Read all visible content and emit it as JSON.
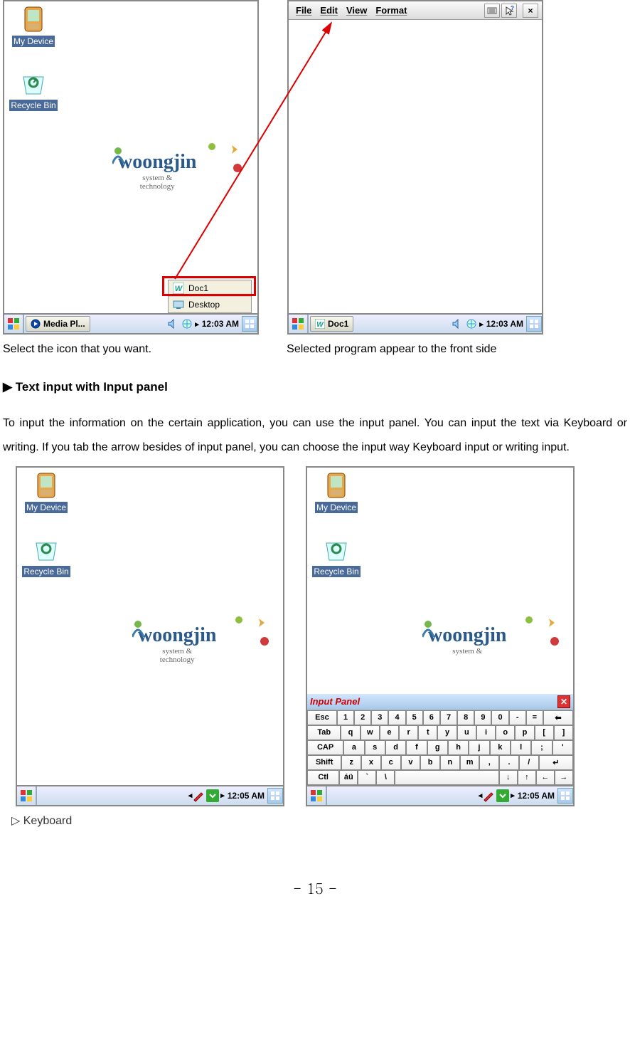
{
  "row1": {
    "leftDevice": {
      "icons": {
        "myDevice": "My Device",
        "recycleBin": "Recycle Bin"
      },
      "logo": {
        "brand": "woongjin",
        "sub": "system &\ntechnology"
      },
      "popup": {
        "doc": "Doc1",
        "desktop": "Desktop"
      },
      "taskbar": {
        "task": "Media Pl...",
        "time": "12:03 AM"
      },
      "caption": "Select the icon that you want."
    },
    "rightDevice": {
      "menu": {
        "file": "File",
        "edit": "Edit",
        "view": "View",
        "format": "Format"
      },
      "closeX": "×",
      "taskbar": {
        "task": "Doc1",
        "time": "12:03 AM"
      },
      "caption": "Selected program appear to the front side"
    }
  },
  "heading1": "▶ Text input with Input panel",
  "para1": "To input the information on the certain application, you can use the input panel. You can input the text via Keyboard or writing. If you tab the arrow besides of input panel, you can choose the input way Keyboard input or writing input.",
  "row2": {
    "leftDevice": {
      "icons": {
        "myDevice": "My Device",
        "recycleBin": "Recycle Bin"
      },
      "logo": {
        "brand": "woongjin",
        "sub": "system &\ntechnology"
      },
      "taskbar": {
        "time": "12:05 AM"
      }
    },
    "rightDevice": {
      "icons": {
        "myDevice": "My Device",
        "recycleBin": "Recycle Bin"
      },
      "logo": {
        "brand": "woongjin",
        "sub": "system &"
      },
      "inputPanel": {
        "title": "Input Panel",
        "rows": [
          [
            "Esc",
            "1",
            "2",
            "3",
            "4",
            "5",
            "6",
            "7",
            "8",
            "9",
            "0",
            "-",
            "=",
            "⬅"
          ],
          [
            "Tab",
            "q",
            "w",
            "e",
            "r",
            "t",
            "y",
            "u",
            "i",
            "o",
            "p",
            "[",
            "]"
          ],
          [
            "CAP",
            "a",
            "s",
            "d",
            "f",
            "g",
            "h",
            "j",
            "k",
            "l",
            ";",
            "'"
          ],
          [
            "Shift",
            "z",
            "x",
            "c",
            "v",
            "b",
            "n",
            "m",
            ",",
            ".",
            "/",
            "↵"
          ],
          [
            "Ctl",
            "áü",
            "`",
            "\\",
            " ",
            "↓",
            "↑",
            "←",
            "→"
          ]
        ]
      },
      "taskbar": {
        "time": "12:05 AM"
      }
    }
  },
  "subcaption": "▷ Keyboard",
  "pageNumber": "- 15 -"
}
